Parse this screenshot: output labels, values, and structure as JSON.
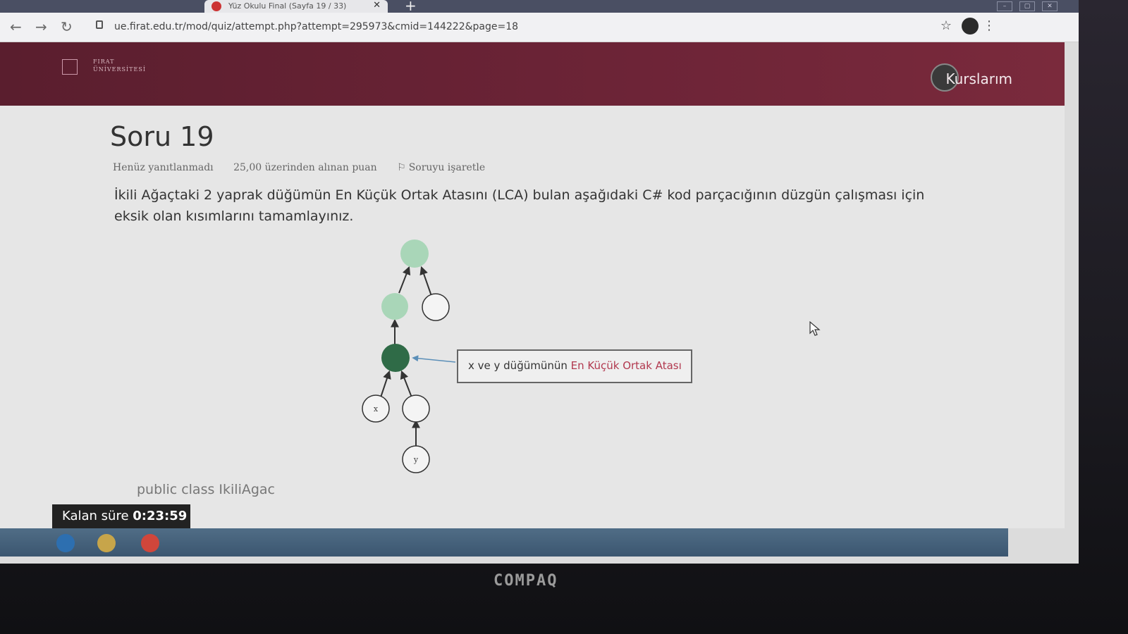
{
  "browser": {
    "tab_title": "Yüz Okulu Final (Sayfa 19 / 33)",
    "url": "ue.firat.edu.tr/mod/quiz/attempt.php?attempt=295973&cmid=144222&page=18"
  },
  "site": {
    "logo_text": "FIRAT ÜNİVERSİTESİ",
    "nav_label": "Kurslarım"
  },
  "question": {
    "title": "Soru 19",
    "status": "Henüz yanıtlanmadı",
    "points": "25,00 üzerinden alınan puan",
    "flag_label": "Soruyu işaretle",
    "text": "İkili Ağaçtaki 2 yaprak düğümün En Küçük Ortak Atasını (LCA) bulan aşağıdaki C# kod parçacığının düzgün çalışması için eksik olan kısımlarını tamamlayınız."
  },
  "diagram": {
    "node_x_label": "x",
    "node_y_label": "y",
    "callout_prefix": "x ve y düğümünün",
    "callout_highlight": "En Küçük Ortak Atası",
    "colors": {
      "light_green": "#a9d6b8",
      "dark_green": "#2f6b47",
      "highlight": "#b2394f"
    }
  },
  "code": {
    "first_line": "public class IkiliAgac"
  },
  "timer": {
    "label": "Kalan süre",
    "value": "0:23:59"
  },
  "device": {
    "brand": "COMPAQ"
  }
}
